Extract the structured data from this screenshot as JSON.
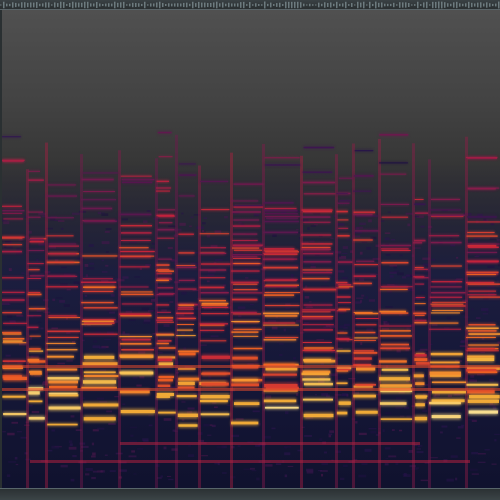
{
  "app": {
    "view": "spectrogram"
  },
  "spectrogram": {
    "colormap": [
      "#0b0d2a",
      "#2c1450",
      "#7a1a4e",
      "#c8243a",
      "#f26522",
      "#f6b43a",
      "#fff3b0"
    ],
    "background_top": "#505050",
    "background_bottom": "#16161c"
  },
  "chrome": {
    "frame_color": "#5a6468",
    "panel_color": "#222628"
  }
}
